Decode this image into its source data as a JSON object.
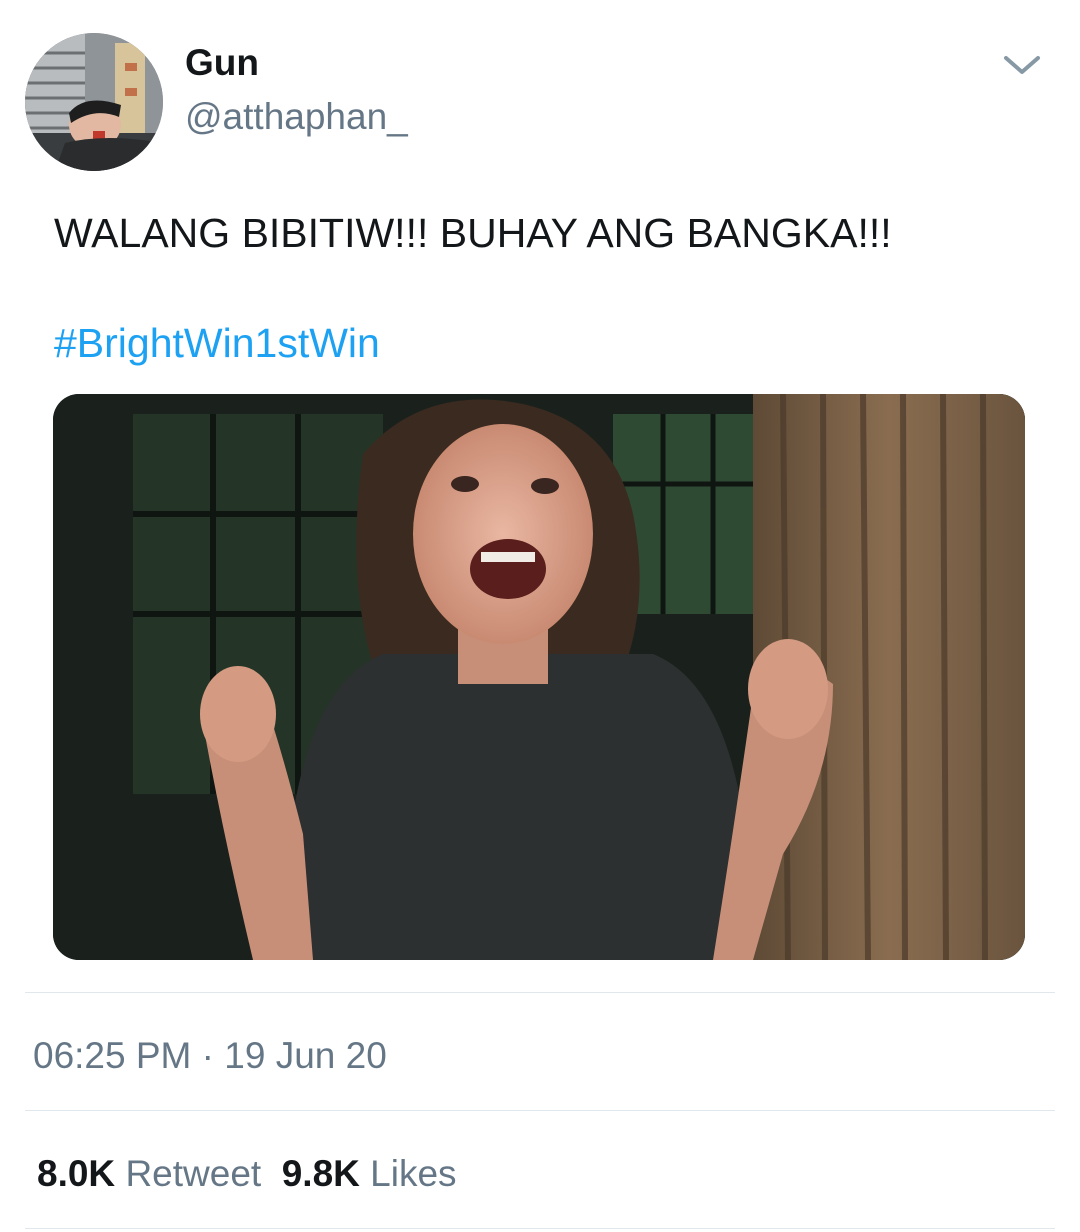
{
  "user": {
    "display_name": "Gun",
    "handle": "@atthaphan_",
    "avatar_icon": "profile-photo"
  },
  "menu": {
    "icon": "chevron-down-icon"
  },
  "tweet": {
    "text": "WALANG BIBITIW!!! BUHAY ANG BANGKA!!!",
    "hashtag": "#BrightWin1stWin"
  },
  "media": {
    "type": "gif",
    "icon": "media-gif"
  },
  "meta": {
    "time": "06:25 PM",
    "separator": " · ",
    "date": "19 Jun 20"
  },
  "stats": {
    "retweet_count": "8.0K",
    "retweet_label": "Retweet",
    "like_count": "9.8K",
    "like_label": "Likes"
  },
  "colors": {
    "link": "#1da1f2",
    "secondary_text": "#657786",
    "primary_text": "#14171a",
    "divider": "#e1e8ed"
  }
}
